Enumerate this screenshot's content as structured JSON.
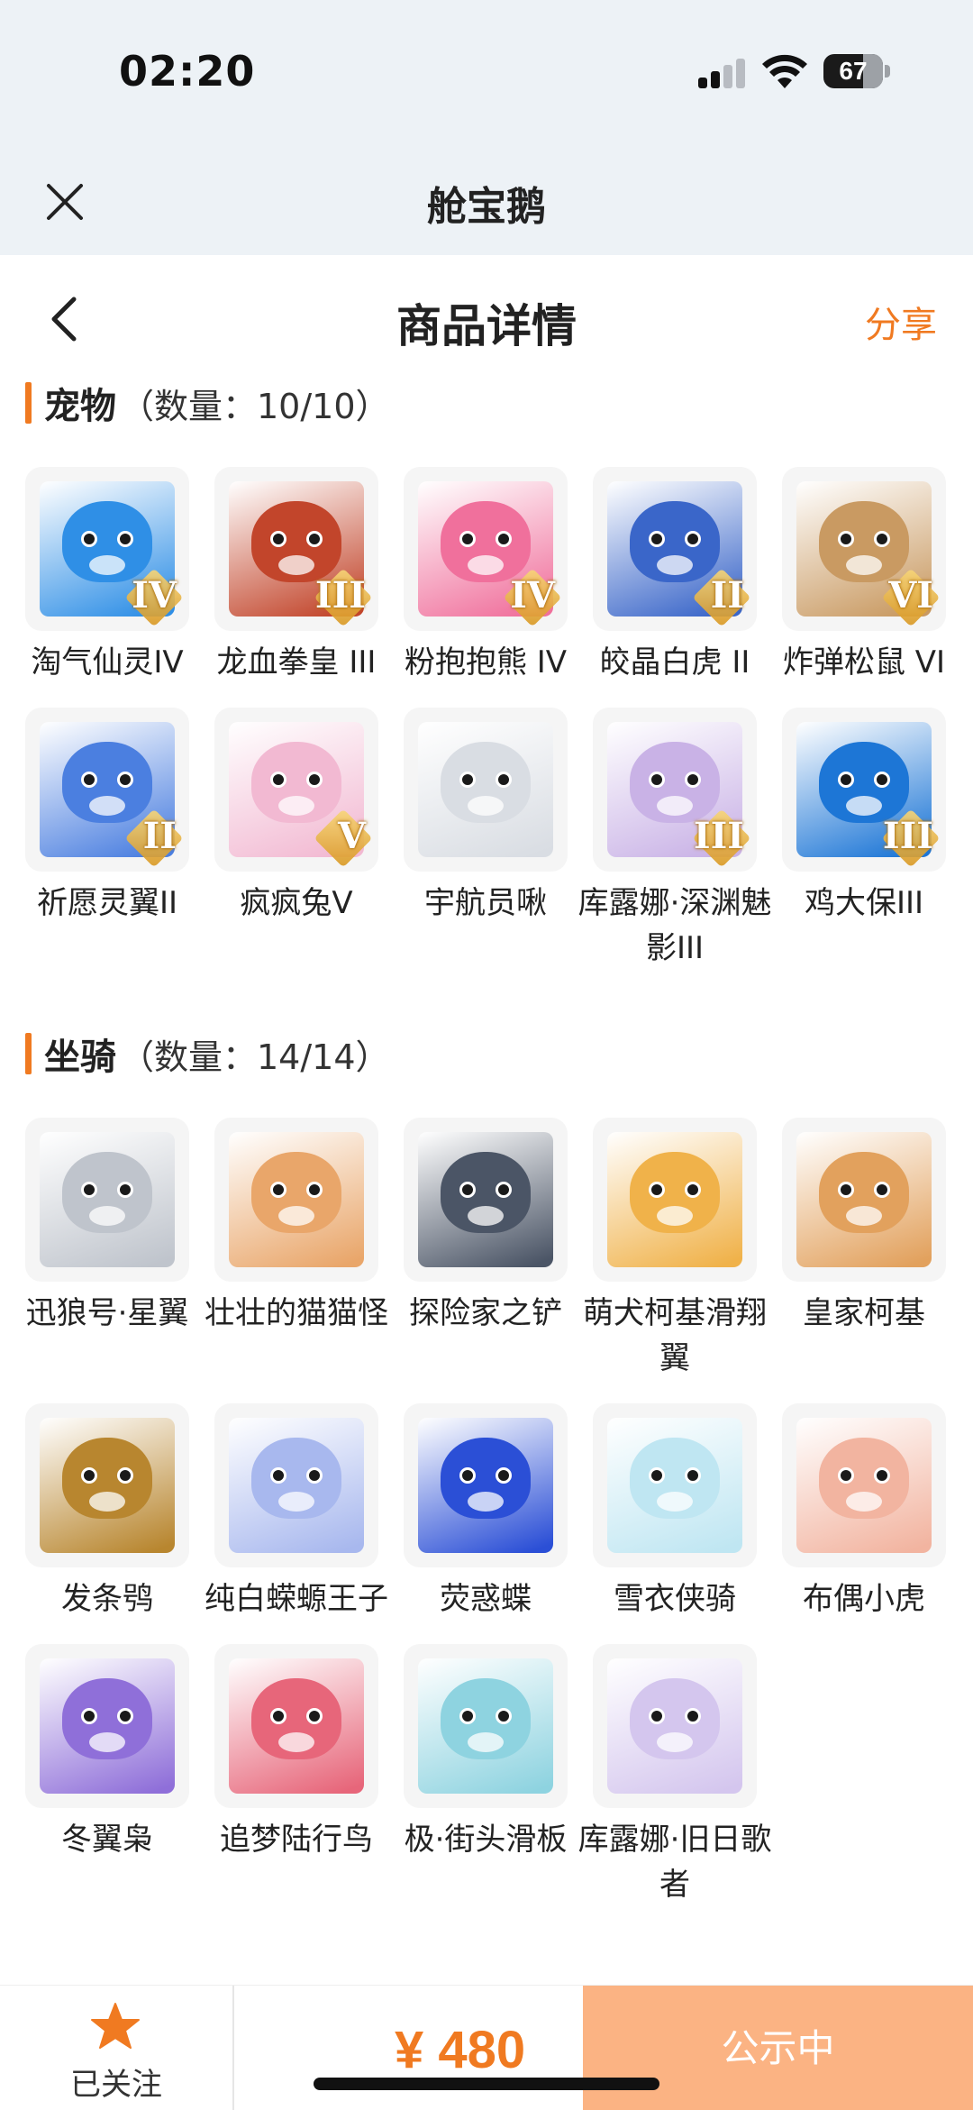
{
  "status_bar": {
    "time": "02:20",
    "battery": "67"
  },
  "mini_app": {
    "title": "舱宝鹅"
  },
  "nav": {
    "title": "商品详情",
    "share": "分享"
  },
  "pets": {
    "label": "宠物",
    "count": "（数量：10/10）",
    "items": [
      {
        "name": "淘气仙灵IV",
        "badge": "IV",
        "color": "#2f8fe6"
      },
      {
        "name": "龙血拳皇 III",
        "badge": "III",
        "color": "#c2452b"
      },
      {
        "name": "粉抱抱熊 IV",
        "badge": "IV",
        "color": "#f0709c"
      },
      {
        "name": "皎晶白虎 II",
        "badge": "II",
        "color": "#3a66c9"
      },
      {
        "name": "炸弹松鼠 VI",
        "badge": "VI",
        "color": "#c99a62"
      },
      {
        "name": "祈愿灵翼II",
        "badge": "II",
        "color": "#4b7fe0"
      },
      {
        "name": "疯疯兔V",
        "badge": "V",
        "color": "#f2b9d2"
      },
      {
        "name": "宇航员啾",
        "badge": "",
        "color": "#d9dde3"
      },
      {
        "name": "库露娜·深渊魅影III",
        "badge": "III",
        "color": "#c9b2e6"
      },
      {
        "name": "鸡大保III",
        "badge": "III",
        "color": "#1d76d6"
      }
    ]
  },
  "mounts": {
    "label": "坐骑",
    "count": "（数量：14/14）",
    "items": [
      {
        "name": "迅狼号·星翼",
        "color": "#bfc4cc"
      },
      {
        "name": "壮壮的猫猫怪",
        "color": "#e9a66a"
      },
      {
        "name": "探险家之铲",
        "color": "#4b5566"
      },
      {
        "name": "萌犬柯基滑翔翼",
        "color": "#f0b24a"
      },
      {
        "name": "皇家柯基",
        "color": "#e2a15d"
      },
      {
        "name": "发条鸮",
        "color": "#b8862f"
      },
      {
        "name": "纯白蝾螈王子",
        "color": "#a8b8ee"
      },
      {
        "name": "荧惑蝶",
        "color": "#2b4fd6"
      },
      {
        "name": "雪衣侠骑",
        "color": "#bfe6f2"
      },
      {
        "name": "布偶小虎",
        "color": "#f2b4a0"
      },
      {
        "name": "冬翼枭",
        "color": "#8f6fd9"
      },
      {
        "name": "追梦陆行鸟",
        "color": "#e7667a"
      },
      {
        "name": "极·街头滑板",
        "color": "#8ed3e0"
      },
      {
        "name": "库露娜·旧日歌者",
        "color": "#d4c6ee"
      }
    ]
  },
  "bottom": {
    "follow_label": "已关注",
    "price": "¥ 480",
    "button_label": "公示中",
    "accent": "#f07a21"
  }
}
